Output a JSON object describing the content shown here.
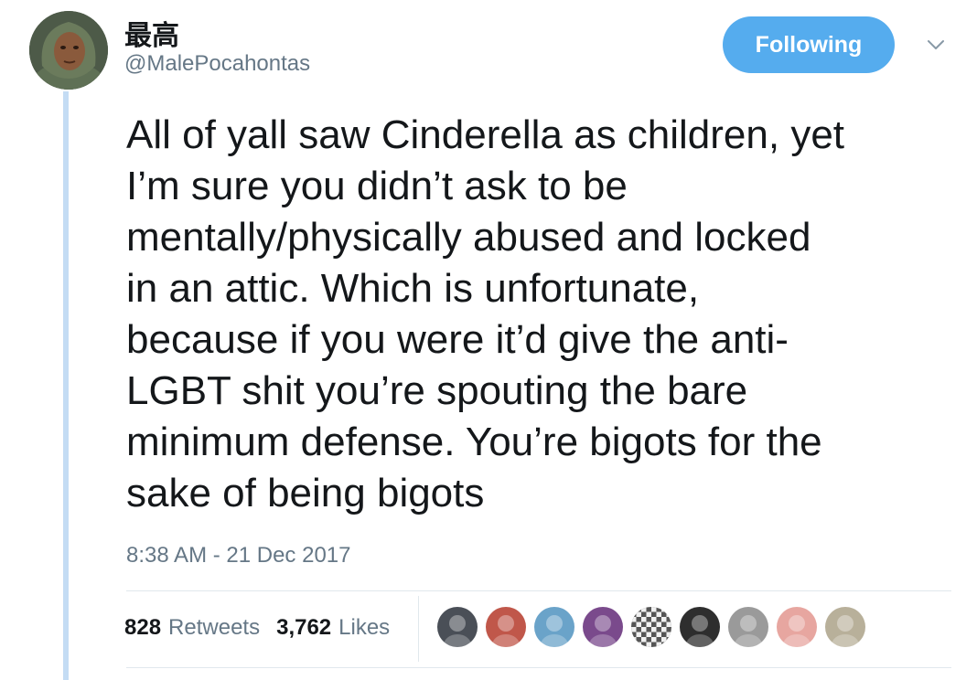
{
  "author": {
    "display_name": "最高",
    "handle": "@MalePocahontas"
  },
  "follow_button": {
    "label": "Following",
    "color": "#55acee"
  },
  "menu": {
    "icon": "chevron-down-icon"
  },
  "tweet": {
    "text": "All of yall saw Cinderella as children, yet\nI’m sure you didn’t ask to be\nmentally/physically abused and locked\nin an attic. Which is unfortunate,\nbecause if you were it’d give the anti-\nLGBT shit you’re spouting the bare\nminimum defense. You’re bigots for the\nsake of being bigots",
    "timestamp": "8:38 AM - 21 Dec 2017"
  },
  "stats": {
    "retweets_count": "828",
    "retweets_label": "Retweets",
    "likes_count": "3,762",
    "likes_label": "Likes"
  },
  "likers": [
    {
      "icon": "liker-avatar-icon",
      "color": "#4a4f57"
    },
    {
      "icon": "liker-avatar-icon",
      "color": "#c0574a"
    },
    {
      "icon": "liker-avatar-icon",
      "color": "#6aa3c9"
    },
    {
      "icon": "liker-avatar-icon",
      "color": "#7a4a8c"
    },
    {
      "icon": "liker-avatar-icon",
      "color": "#555555"
    },
    {
      "icon": "liker-avatar-icon",
      "color": "#2e2e2e"
    },
    {
      "icon": "liker-avatar-icon",
      "color": "#9a9a9a"
    },
    {
      "icon": "liker-avatar-icon",
      "color": "#e7a6a0"
    },
    {
      "icon": "liker-avatar-icon",
      "color": "#b8b09a"
    }
  ],
  "colors": {
    "thread_line": "#c4dcf4",
    "secondary_text": "#657786",
    "primary_text": "#14171a"
  }
}
